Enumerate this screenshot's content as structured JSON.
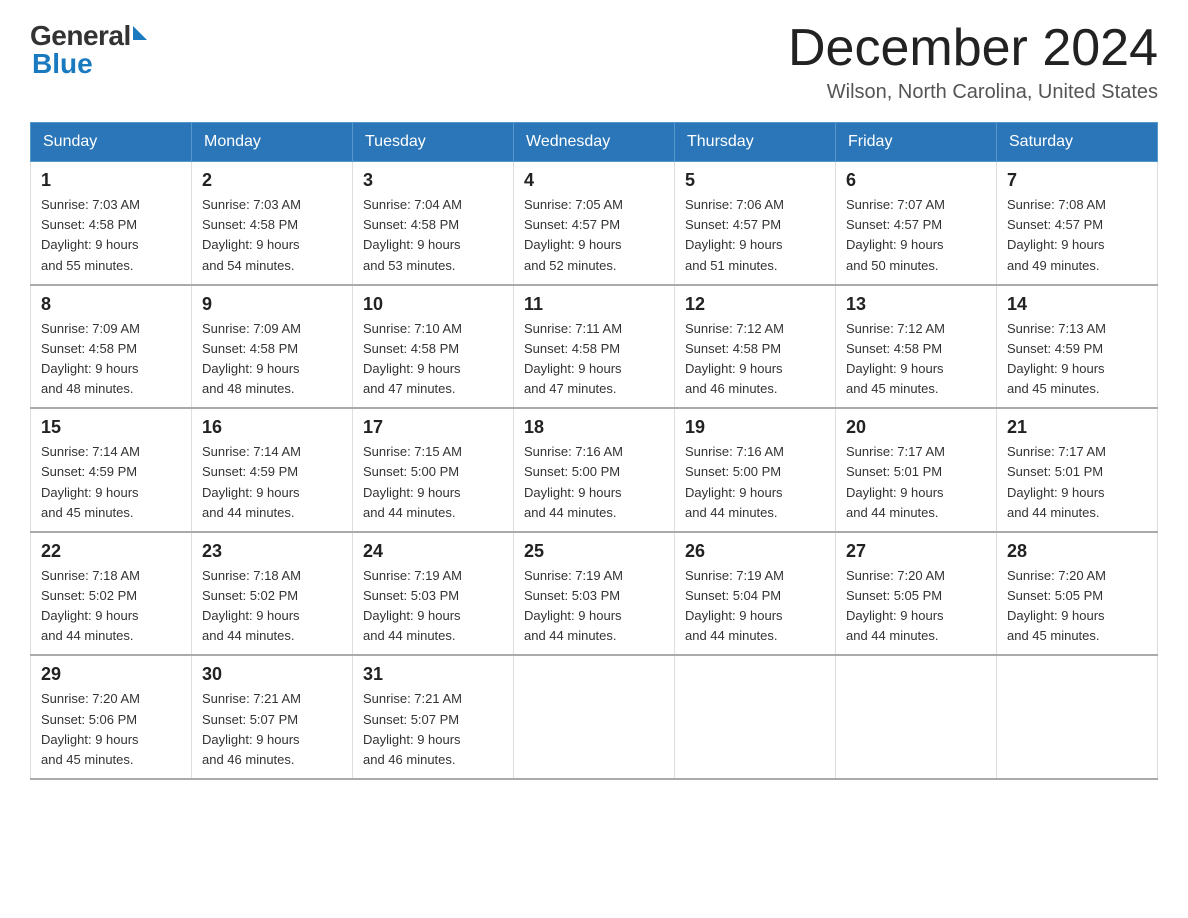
{
  "logo": {
    "general": "General",
    "blue": "Blue"
  },
  "title": "December 2024",
  "subtitle": "Wilson, North Carolina, United States",
  "days_of_week": [
    "Sunday",
    "Monday",
    "Tuesday",
    "Wednesday",
    "Thursday",
    "Friday",
    "Saturday"
  ],
  "weeks": [
    [
      {
        "day": "1",
        "sunrise": "7:03 AM",
        "sunset": "4:58 PM",
        "daylight": "9 hours and 55 minutes."
      },
      {
        "day": "2",
        "sunrise": "7:03 AM",
        "sunset": "4:58 PM",
        "daylight": "9 hours and 54 minutes."
      },
      {
        "day": "3",
        "sunrise": "7:04 AM",
        "sunset": "4:58 PM",
        "daylight": "9 hours and 53 minutes."
      },
      {
        "day": "4",
        "sunrise": "7:05 AM",
        "sunset": "4:57 PM",
        "daylight": "9 hours and 52 minutes."
      },
      {
        "day": "5",
        "sunrise": "7:06 AM",
        "sunset": "4:57 PM",
        "daylight": "9 hours and 51 minutes."
      },
      {
        "day": "6",
        "sunrise": "7:07 AM",
        "sunset": "4:57 PM",
        "daylight": "9 hours and 50 minutes."
      },
      {
        "day": "7",
        "sunrise": "7:08 AM",
        "sunset": "4:57 PM",
        "daylight": "9 hours and 49 minutes."
      }
    ],
    [
      {
        "day": "8",
        "sunrise": "7:09 AM",
        "sunset": "4:58 PM",
        "daylight": "9 hours and 48 minutes."
      },
      {
        "day": "9",
        "sunrise": "7:09 AM",
        "sunset": "4:58 PM",
        "daylight": "9 hours and 48 minutes."
      },
      {
        "day": "10",
        "sunrise": "7:10 AM",
        "sunset": "4:58 PM",
        "daylight": "9 hours and 47 minutes."
      },
      {
        "day": "11",
        "sunrise": "7:11 AM",
        "sunset": "4:58 PM",
        "daylight": "9 hours and 47 minutes."
      },
      {
        "day": "12",
        "sunrise": "7:12 AM",
        "sunset": "4:58 PM",
        "daylight": "9 hours and 46 minutes."
      },
      {
        "day": "13",
        "sunrise": "7:12 AM",
        "sunset": "4:58 PM",
        "daylight": "9 hours and 45 minutes."
      },
      {
        "day": "14",
        "sunrise": "7:13 AM",
        "sunset": "4:59 PM",
        "daylight": "9 hours and 45 minutes."
      }
    ],
    [
      {
        "day": "15",
        "sunrise": "7:14 AM",
        "sunset": "4:59 PM",
        "daylight": "9 hours and 45 minutes."
      },
      {
        "day": "16",
        "sunrise": "7:14 AM",
        "sunset": "4:59 PM",
        "daylight": "9 hours and 44 minutes."
      },
      {
        "day": "17",
        "sunrise": "7:15 AM",
        "sunset": "5:00 PM",
        "daylight": "9 hours and 44 minutes."
      },
      {
        "day": "18",
        "sunrise": "7:16 AM",
        "sunset": "5:00 PM",
        "daylight": "9 hours and 44 minutes."
      },
      {
        "day": "19",
        "sunrise": "7:16 AM",
        "sunset": "5:00 PM",
        "daylight": "9 hours and 44 minutes."
      },
      {
        "day": "20",
        "sunrise": "7:17 AM",
        "sunset": "5:01 PM",
        "daylight": "9 hours and 44 minutes."
      },
      {
        "day": "21",
        "sunrise": "7:17 AM",
        "sunset": "5:01 PM",
        "daylight": "9 hours and 44 minutes."
      }
    ],
    [
      {
        "day": "22",
        "sunrise": "7:18 AM",
        "sunset": "5:02 PM",
        "daylight": "9 hours and 44 minutes."
      },
      {
        "day": "23",
        "sunrise": "7:18 AM",
        "sunset": "5:02 PM",
        "daylight": "9 hours and 44 minutes."
      },
      {
        "day": "24",
        "sunrise": "7:19 AM",
        "sunset": "5:03 PM",
        "daylight": "9 hours and 44 minutes."
      },
      {
        "day": "25",
        "sunrise": "7:19 AM",
        "sunset": "5:03 PM",
        "daylight": "9 hours and 44 minutes."
      },
      {
        "day": "26",
        "sunrise": "7:19 AM",
        "sunset": "5:04 PM",
        "daylight": "9 hours and 44 minutes."
      },
      {
        "day": "27",
        "sunrise": "7:20 AM",
        "sunset": "5:05 PM",
        "daylight": "9 hours and 44 minutes."
      },
      {
        "day": "28",
        "sunrise": "7:20 AM",
        "sunset": "5:05 PM",
        "daylight": "9 hours and 45 minutes."
      }
    ],
    [
      {
        "day": "29",
        "sunrise": "7:20 AM",
        "sunset": "5:06 PM",
        "daylight": "9 hours and 45 minutes."
      },
      {
        "day": "30",
        "sunrise": "7:21 AM",
        "sunset": "5:07 PM",
        "daylight": "9 hours and 46 minutes."
      },
      {
        "day": "31",
        "sunrise": "7:21 AM",
        "sunset": "5:07 PM",
        "daylight": "9 hours and 46 minutes."
      },
      null,
      null,
      null,
      null
    ]
  ],
  "labels": {
    "sunrise": "Sunrise:",
    "sunset": "Sunset:",
    "daylight": "Daylight:"
  }
}
